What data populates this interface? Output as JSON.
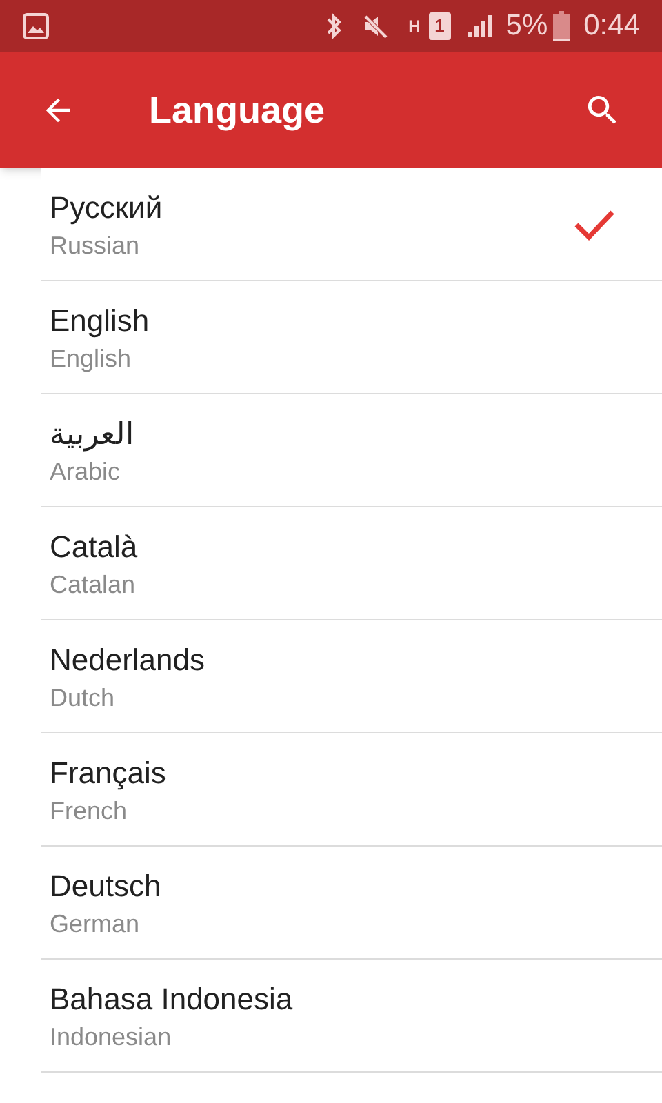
{
  "status_bar": {
    "network_type": "H",
    "sim": "1",
    "battery": "5%",
    "time": "0:44"
  },
  "app_bar": {
    "title": "Language"
  },
  "languages": [
    {
      "name": "Русский",
      "english": "Russian",
      "selected": true
    },
    {
      "name": "English",
      "english": "English",
      "selected": false
    },
    {
      "name": "العربية",
      "english": "Arabic",
      "selected": false
    },
    {
      "name": "Català",
      "english": "Catalan",
      "selected": false
    },
    {
      "name": "Nederlands",
      "english": "Dutch",
      "selected": false
    },
    {
      "name": "Français",
      "english": "French",
      "selected": false
    },
    {
      "name": "Deutsch",
      "english": "German",
      "selected": false
    },
    {
      "name": "Bahasa Indonesia",
      "english": "Indonesian",
      "selected": false
    }
  ]
}
